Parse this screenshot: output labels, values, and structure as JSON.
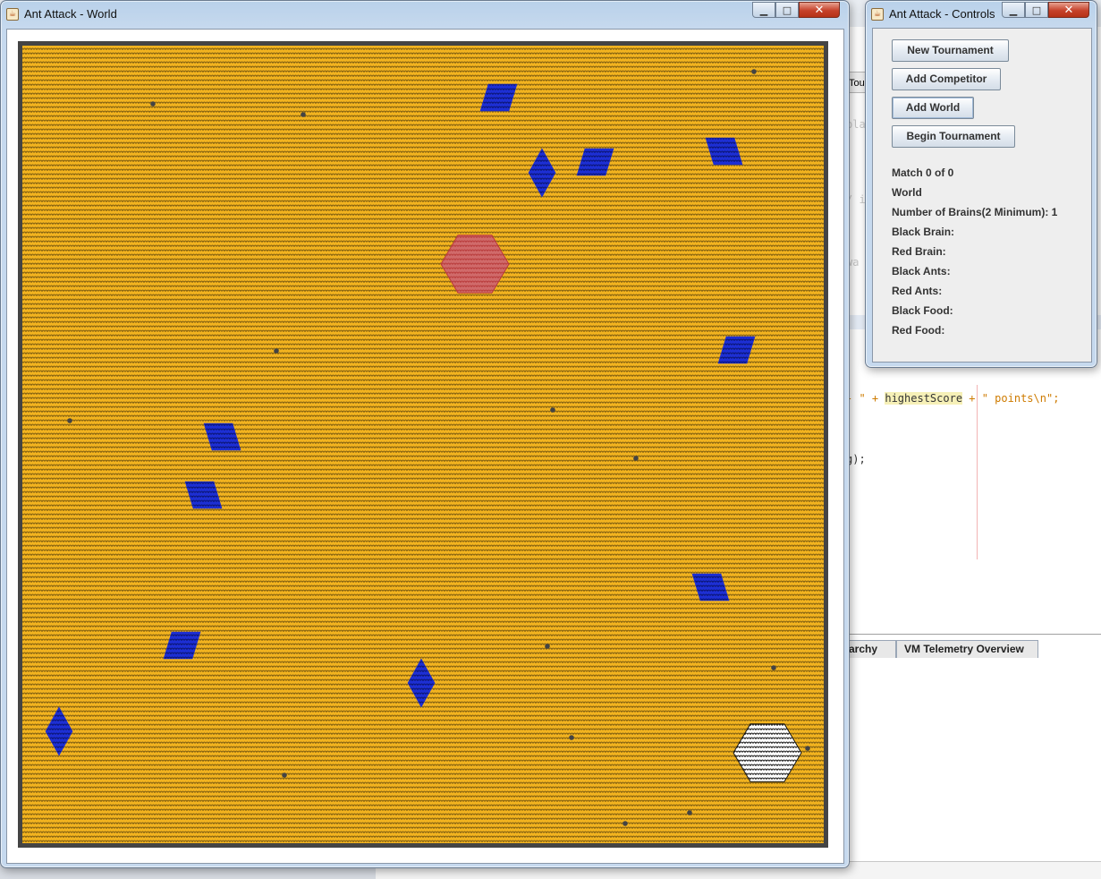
{
  "world_window": {
    "title": "Ant Attack - World",
    "colors": {
      "ground": "#f2b31f",
      "cell_outline": "#7a5a10",
      "rock": "#444444",
      "food": "#1d2fd4",
      "red_hill": "#b83a3a",
      "black_hill": "#111111"
    }
  },
  "controls_window": {
    "title": "Ant Attack - Controls",
    "buttons": {
      "new_tournament": "New Tournament",
      "add_competitor": "Add Competitor",
      "add_world": "Add World",
      "begin_tournament": "Begin Tournament"
    },
    "status": {
      "match": "Match 0 of 0",
      "world": "World",
      "number_of_brains": "Number of Brains(2 Minimum): 1",
      "black_brain": "Black Brain:",
      "red_brain": "Red Brain:",
      "black_ants": "Black Ants:",
      "red_ants": "Red Ants:",
      "black_food": "Black Food:",
      "red_food": "Red Food:"
    }
  },
  "background_ide": {
    "tab_stub": "Tou",
    "code": {
      "line1": "pla",
      "line2": "/ i",
      "line3": "wa",
      "line4_pre": "- \" + ",
      "line4_var": "highestScore",
      "line4_post": " + \" points\\n\";",
      "line5": "g);"
    },
    "bottom_tabs": [
      "archy",
      "VM Telemetry Overview"
    ]
  }
}
